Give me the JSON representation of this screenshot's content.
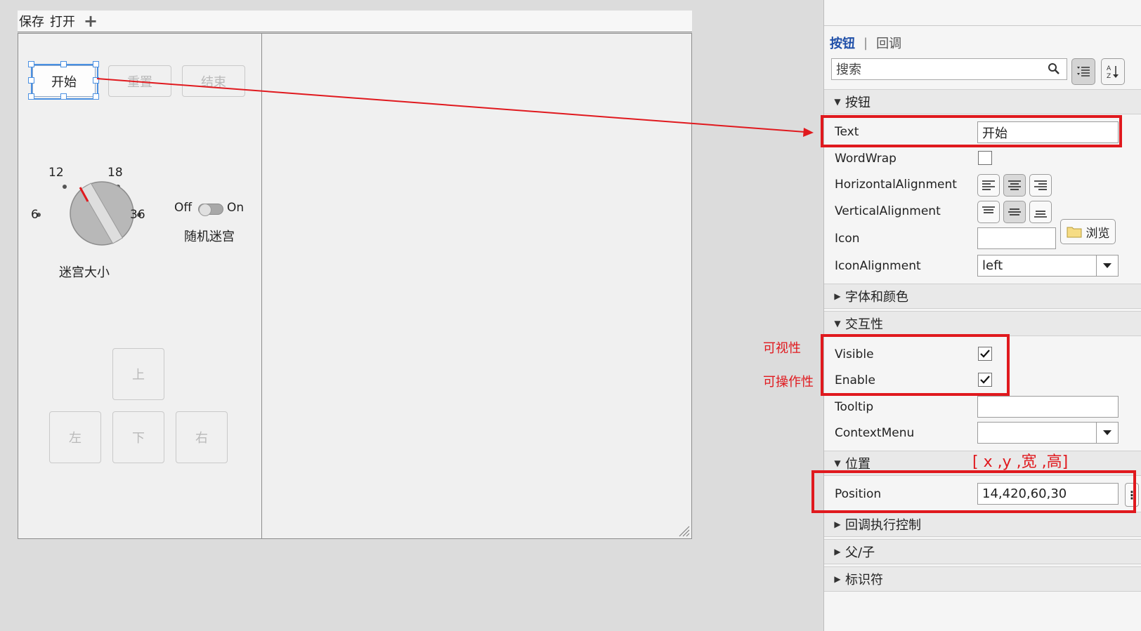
{
  "toolbar": {
    "save": "保存",
    "open": "打开",
    "add_icon": "plus-icon"
  },
  "canvas": {
    "buttons": {
      "start": "开始",
      "reset": "重置",
      "end": "结束"
    },
    "knob": {
      "ticks": [
        "6",
        "12",
        "18",
        "36"
      ],
      "label": "迷宫大小"
    },
    "switch": {
      "off": "Off",
      "on": "On",
      "label": "随机迷宫"
    },
    "arrows": {
      "up": "上",
      "left": "左",
      "down": "下",
      "right": "右"
    }
  },
  "inspector": {
    "tabs": {
      "active": "按钮",
      "other": "回调"
    },
    "search_placeholder": "搜索",
    "sections": {
      "button": "按钮",
      "font_color": "字体和颜色",
      "interactivity": "交互性",
      "position": "位置",
      "callback": "回调执行控制",
      "parent_child": "父/子",
      "identifier": "标识符"
    },
    "props": {
      "text_name": "Text",
      "text_value": "开始",
      "wordwrap_name": "WordWrap",
      "halign_name": "HorizontalAlignment",
      "valign_name": "VerticalAlignment",
      "icon_name": "Icon",
      "browse_label": "浏览",
      "iconalign_name": "IconAlignment",
      "iconalign_value": "left",
      "visible_name": "Visible",
      "enable_name": "Enable",
      "tooltip_name": "Tooltip",
      "contextmenu_name": "ContextMenu",
      "position_name": "Position",
      "position_value": "14,420,60,30"
    }
  },
  "annotations": {
    "visible_note": "可视性",
    "enable_note": "可操作性",
    "position_note": "[ x ,y ,宽 ,高]"
  },
  "colors": {
    "annotation_red": "#e0191e",
    "tab_blue": "#1f4fa8",
    "selection_blue": "#4a90e2"
  }
}
